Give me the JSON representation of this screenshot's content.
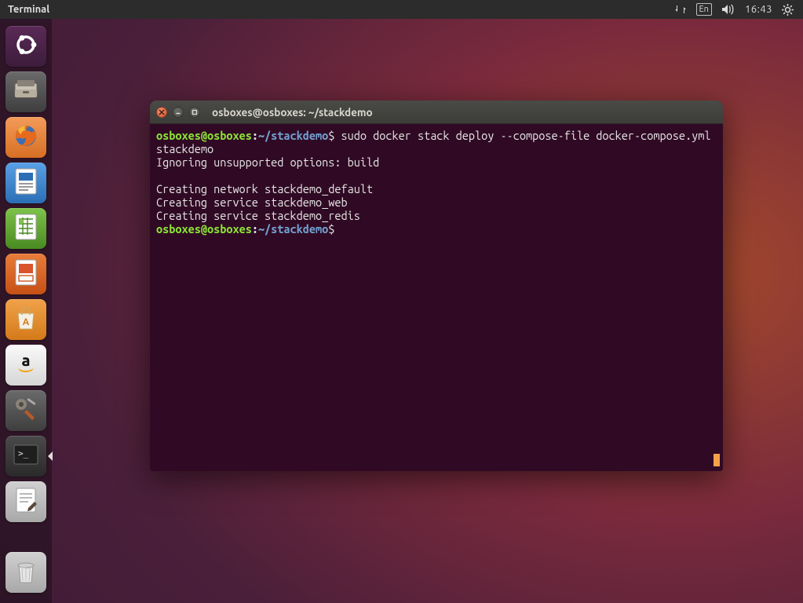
{
  "top_panel": {
    "app_title": "Terminal",
    "lang": "En",
    "time": "16:43"
  },
  "launcher": {
    "items": [
      {
        "name": "dash",
        "label": "Dash"
      },
      {
        "name": "files",
        "label": "Files"
      },
      {
        "name": "firefox",
        "label": "Firefox"
      },
      {
        "name": "writer",
        "label": "LibreOffice Writer"
      },
      {
        "name": "calc",
        "label": "LibreOffice Calc"
      },
      {
        "name": "impress",
        "label": "LibreOffice Impress"
      },
      {
        "name": "software",
        "label": "Ubuntu Software"
      },
      {
        "name": "amazon",
        "label": "Amazon"
      },
      {
        "name": "settings",
        "label": "System Settings"
      },
      {
        "name": "terminal",
        "label": "Terminal"
      },
      {
        "name": "texteditor",
        "label": "Text Editor"
      }
    ],
    "trash_label": "Trash"
  },
  "terminal": {
    "title": "osboxes@osboxes: ~/stackdemo",
    "prompt": {
      "user": "osboxes",
      "host": "osboxes",
      "path": "~/stackdemo",
      "symbol": "$"
    },
    "command1": " sudo docker stack deploy --compose-file docker-compose.yml stackdemo",
    "output_lines": [
      "Ignoring unsupported options: build",
      "",
      "Creating network stackdemo_default",
      "Creating service stackdemo_web",
      "Creating service stackdemo_redis"
    ],
    "command2": " "
  }
}
